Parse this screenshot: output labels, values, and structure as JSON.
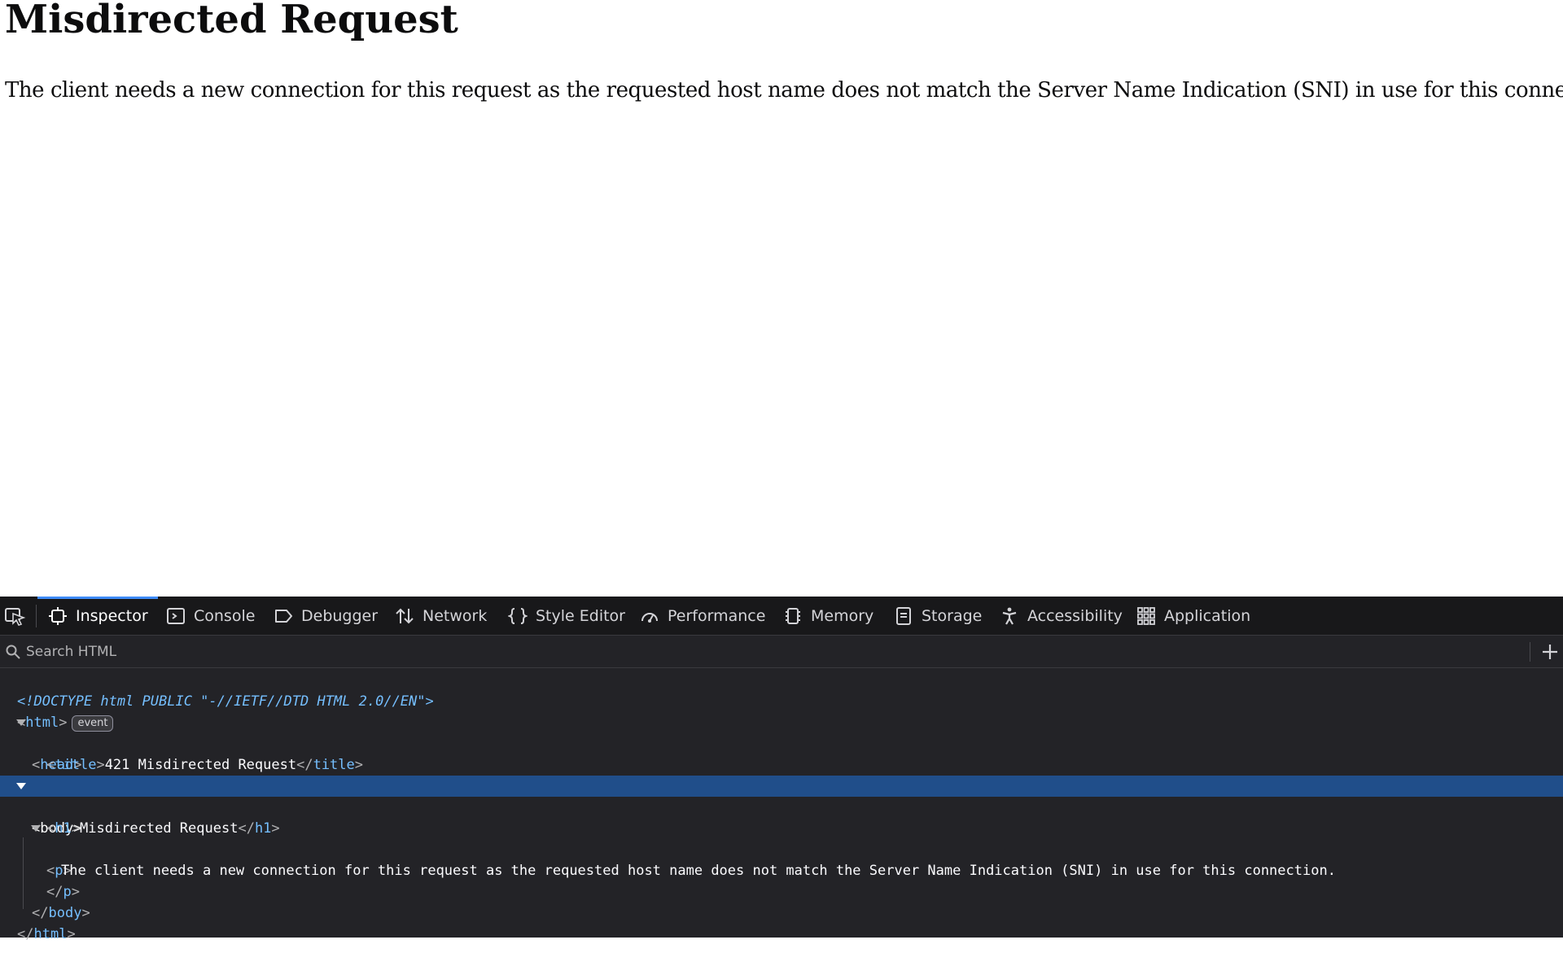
{
  "page": {
    "heading": "Misdirected Request",
    "paragraph": "The client needs a new connection for this request as the requested host name does not match the Server Name Indication (SNI) in use for this connection."
  },
  "devtools": {
    "tabs": [
      {
        "label": "Inspector",
        "icon": "inspector-icon",
        "active": true
      },
      {
        "label": "Console",
        "icon": "console-icon"
      },
      {
        "label": "Debugger",
        "icon": "debugger-icon"
      },
      {
        "label": "Network",
        "icon": "network-icon"
      },
      {
        "label": "Style Editor",
        "icon": "style-editor-icon"
      },
      {
        "label": "Performance",
        "icon": "performance-icon"
      },
      {
        "label": "Memory",
        "icon": "memory-icon"
      },
      {
        "label": "Storage",
        "icon": "storage-icon"
      },
      {
        "label": "Accessibility",
        "icon": "accessibility-icon"
      },
      {
        "label": "Application",
        "icon": "application-icon"
      }
    ],
    "search": {
      "placeholder": "Search HTML"
    },
    "markup": {
      "doctype": "<!DOCTYPE html PUBLIC \"-//IETF//DTD HTML 2.0//EN\">",
      "html_tag": "html",
      "event_badge": "event",
      "head_tag": "head",
      "title_tag": "title",
      "title_text": "421 Misdirected Request",
      "body_tag": "body",
      "h1_tag": "h1",
      "h1_text": "Misdirected Request",
      "p_tag": "p",
      "p_text": "The client needs a new connection for this request as the requested host name does not match the Server Name Indication (SNI) in use for this connection."
    },
    "colors": {
      "selection": "#204e8a",
      "active_tab_indicator": "#3e8bf6",
      "tag": "#75bfff"
    }
  }
}
